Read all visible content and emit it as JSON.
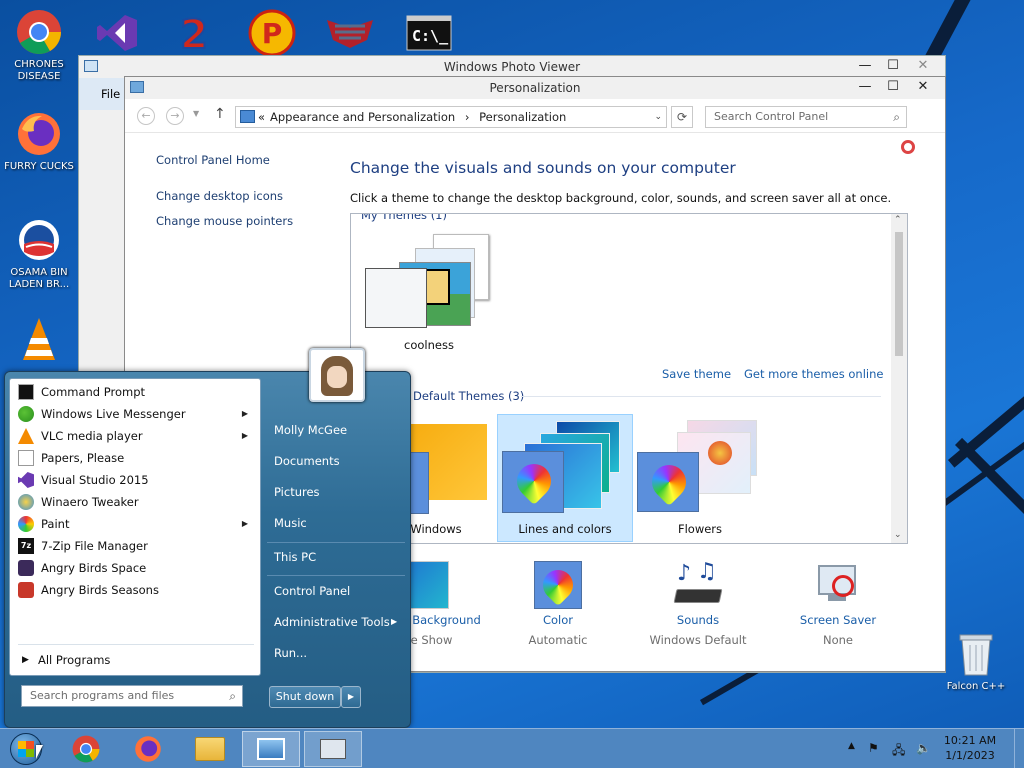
{
  "desktop": {
    "icons": [
      {
        "label_line1": "CHRONES",
        "label_line2": "DISEASE",
        "icon": "chrome-icon"
      },
      {
        "label_line1": "FURRY CUCKS",
        "label_line2": "",
        "icon": "firefox-icon"
      },
      {
        "label_line1": "OSAMA BIN",
        "label_line2": "LADEN BR...",
        "icon": "campaign-logo-icon"
      },
      {
        "label_line1": "",
        "label_line2": "",
        "icon": "vlc-icon"
      }
    ],
    "recycle_bin_label": "Falcon C++",
    "top_icons": [
      "visual-studio-icon",
      "number-2-icon",
      "p-logo-icon",
      "emblem-icon",
      "command-prompt-icon"
    ]
  },
  "photo_viewer": {
    "title": "Windows Photo Viewer",
    "menu_file": "File"
  },
  "control_panel": {
    "title": "Personalization",
    "breadcrumb_prefix": "«",
    "breadcrumb_parent": "Appearance and Personalization",
    "breadcrumb_sep": "›",
    "breadcrumb_current": "Personalization",
    "search_placeholder": "Search Control Panel",
    "left_links": {
      "home": "Control Panel Home",
      "desktop_icons": "Change desktop icons",
      "mouse_pointers": "Change mouse pointers"
    },
    "heading": "Change the visuals and sounds on your computer",
    "subheading": "Click a theme to change the desktop background, color, sounds, and screen saver all at once.",
    "my_themes_header": "My Themes (1)",
    "my_theme_name": "coolness",
    "save_theme": "Save theme",
    "get_more_themes": "Get more themes online",
    "default_themes_header": "Default Themes (3)",
    "default_themes": [
      "Windows",
      "Lines and colors",
      "Flowers"
    ],
    "selected_theme": "Lines and colors",
    "bottom": [
      {
        "label": "Desktop Background",
        "sub": "Slide Show",
        "icon": "desktop-background-icon"
      },
      {
        "label": "Color",
        "sub": "Automatic",
        "icon": "color-palette-icon"
      },
      {
        "label": "Sounds",
        "sub": "Windows Default",
        "icon": "sounds-icon"
      },
      {
        "label": "Screen Saver",
        "sub": "None",
        "icon": "screen-saver-icon"
      }
    ]
  },
  "start_menu": {
    "programs": [
      {
        "label": "Command Prompt",
        "icon": "cmd-icon",
        "arrow": false
      },
      {
        "label": "Windows Live Messenger",
        "icon": "messenger-icon",
        "arrow": true
      },
      {
        "label": "VLC media player",
        "icon": "vlc-icon",
        "arrow": true
      },
      {
        "label": "Papers, Please",
        "icon": "document-icon",
        "arrow": false
      },
      {
        "label": "Visual Studio 2015",
        "icon": "visual-studio-icon",
        "arrow": false
      },
      {
        "label": "Winaero Tweaker",
        "icon": "tweaker-icon",
        "arrow": false
      },
      {
        "label": "Paint",
        "icon": "paint-icon",
        "arrow": true
      },
      {
        "label": "7-Zip File Manager",
        "icon": "7zip-icon",
        "arrow": false
      },
      {
        "label": "Angry Birds Space",
        "icon": "angry-birds-space-icon",
        "arrow": false
      },
      {
        "label": "Angry Birds Seasons",
        "icon": "angry-birds-seasons-icon",
        "arrow": false
      }
    ],
    "all_programs": "All Programs",
    "search_placeholder": "Search programs and files",
    "right": {
      "user": "Molly McGee",
      "documents": "Documents",
      "pictures": "Pictures",
      "music": "Music",
      "this_pc": "This PC",
      "control_panel": "Control Panel",
      "admin_tools": "Administrative Tools",
      "run": "Run..."
    },
    "shutdown": "Shut down"
  },
  "taskbar": {
    "time": "10:21 AM",
    "date": "1/1/2023"
  },
  "colors": {
    "accent_link": "#1a5ea8",
    "selected_theme_bg": "#cce8ff",
    "taskbar": "#4f86c0"
  }
}
